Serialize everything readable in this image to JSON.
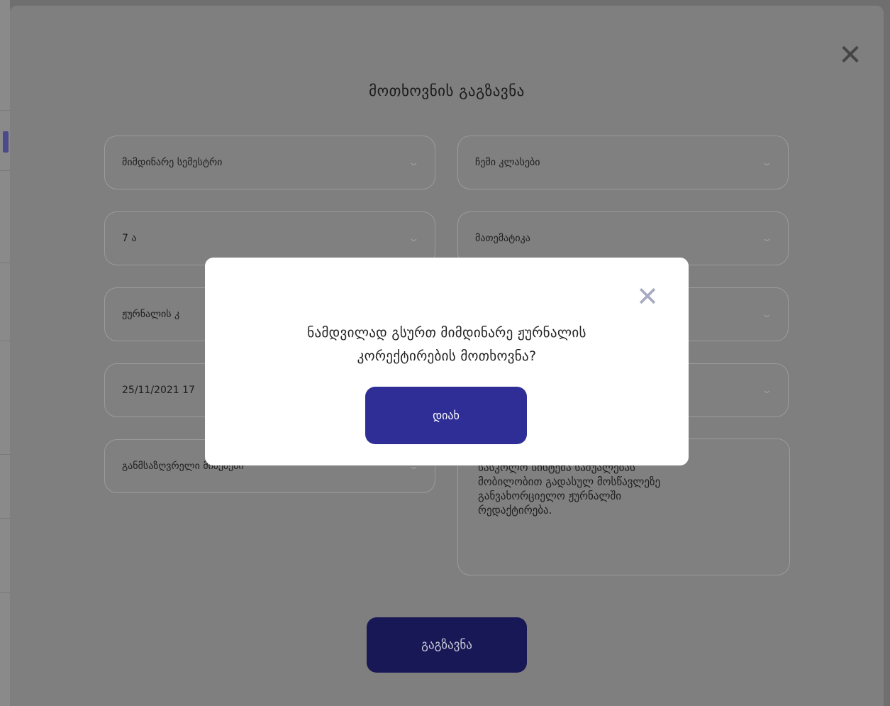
{
  "outer_modal": {
    "title": "მოთხოვნის გაგზავნა",
    "close_symbol": "✕",
    "fields": {
      "semester": "მიმდინარე სემესტრი",
      "my_classes": "ჩემი კლასები",
      "class": "7 ა",
      "subject": "მათემატიკა",
      "journal": "ჟურნალის კ",
      "datetime": "25/11/2021 17",
      "reason": "განმსაზღვრელი მიზეზები"
    },
    "chevron_symbol": "⌄",
    "comment_text": "სასკოლო სისტემა საშუალებას\nმობილობით გადასულ მოსწავლეზე\nგანვახორციელო ჟურნალში\nრედაქტირება.",
    "send_label": "გაგზავნა"
  },
  "confirm_dialog": {
    "message_line1": "ნამდვილად გსურთ მიმდინარე ჟურნალის",
    "message_line2": "კორექტირების მოთხოვნა?",
    "yes_label": "დიახ",
    "close_symbol": "✕"
  }
}
